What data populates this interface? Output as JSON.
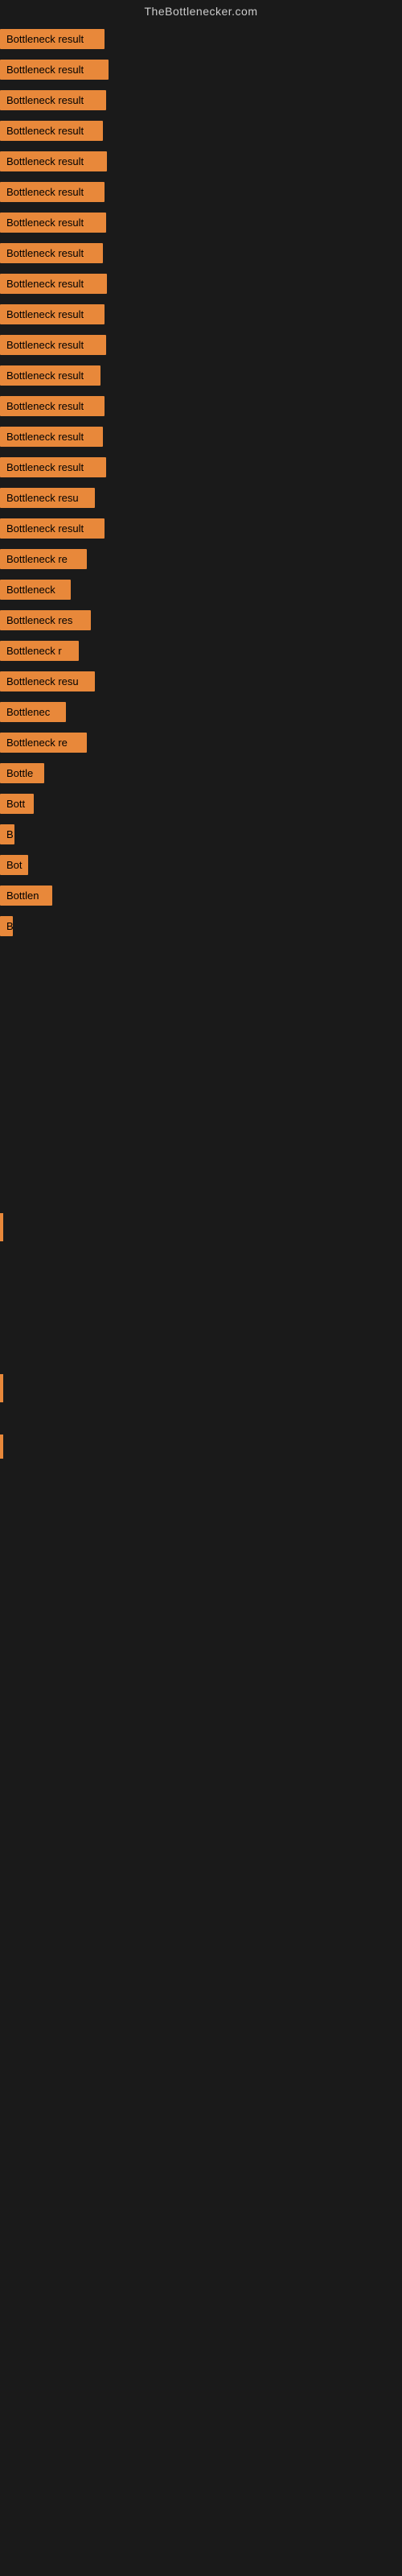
{
  "site": {
    "title": "TheBottlenecker.com"
  },
  "bars": [
    {
      "label": "Bottleneck result",
      "width": 130
    },
    {
      "label": "Bottleneck result",
      "width": 135
    },
    {
      "label": "Bottleneck result",
      "width": 132
    },
    {
      "label": "Bottleneck result",
      "width": 128
    },
    {
      "label": "Bottleneck result",
      "width": 133
    },
    {
      "label": "Bottleneck result",
      "width": 130
    },
    {
      "label": "Bottleneck result",
      "width": 132
    },
    {
      "label": "Bottleneck result",
      "width": 128
    },
    {
      "label": "Bottleneck result",
      "width": 133
    },
    {
      "label": "Bottleneck result",
      "width": 130
    },
    {
      "label": "Bottleneck result",
      "width": 132
    },
    {
      "label": "Bottleneck result",
      "width": 125
    },
    {
      "label": "Bottleneck result",
      "width": 130
    },
    {
      "label": "Bottleneck result",
      "width": 128
    },
    {
      "label": "Bottleneck result",
      "width": 132
    },
    {
      "label": "Bottleneck resu",
      "width": 118
    },
    {
      "label": "Bottleneck result",
      "width": 130
    },
    {
      "label": "Bottleneck re",
      "width": 108
    },
    {
      "label": "Bottleneck",
      "width": 88
    },
    {
      "label": "Bottleneck res",
      "width": 113
    },
    {
      "label": "Bottleneck r",
      "width": 98
    },
    {
      "label": "Bottleneck resu",
      "width": 118
    },
    {
      "label": "Bottlenec",
      "width": 82
    },
    {
      "label": "Bottleneck re",
      "width": 108
    },
    {
      "label": "Bottle",
      "width": 55
    },
    {
      "label": "Bott",
      "width": 42
    },
    {
      "label": "B",
      "width": 18
    },
    {
      "label": "Bot",
      "width": 35
    },
    {
      "label": "Bottlen",
      "width": 65
    },
    {
      "label": "B",
      "width": 16
    }
  ]
}
